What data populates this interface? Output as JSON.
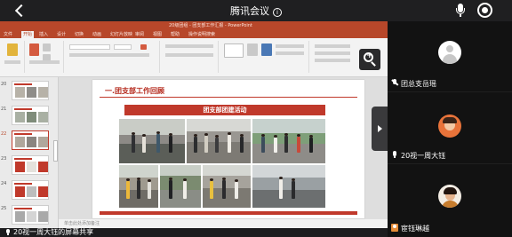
{
  "header": {
    "title": "腾讯会议",
    "info_icon": "info-icon",
    "mic_icon": "mic-icon",
    "record_icon": "record-icon",
    "back_icon": "back-arrow-icon"
  },
  "ppt": {
    "window_title": "20级团组 - 团支部工作汇报 - PowerPoint",
    "menu": [
      "文件",
      "开始",
      "插入",
      "设计",
      "切换",
      "动画",
      "幻灯片放映",
      "审阅",
      "视图",
      "帮助",
      "操作说明搜索"
    ],
    "active_menu": "开始",
    "thumb_numbers": [
      "20",
      "21",
      "22",
      "23",
      "24",
      "25"
    ],
    "active_thumb": "22",
    "slide": {
      "heading": "一.团支部工作回顾",
      "banner": "团支部团建活动"
    },
    "notes_placeholder": "单击此处添加备注"
  },
  "share_status": "20视一周大钰的屏幕共享",
  "participants": [
    {
      "name": "团总支岳瑶",
      "status_icon": "mic-muted-icon",
      "avatar": "default-avatar"
    },
    {
      "name": "20视一周大钰",
      "status_icon": "mic-icon",
      "avatar": "photo-avatar"
    },
    {
      "name": "宦钰琳越",
      "status_icon": "user-icon",
      "avatar": "photo-avatar"
    }
  ],
  "colors": {
    "accent_red": "#c0392b",
    "ppt_red": "#b7472a",
    "background": "#1c1c1e"
  }
}
